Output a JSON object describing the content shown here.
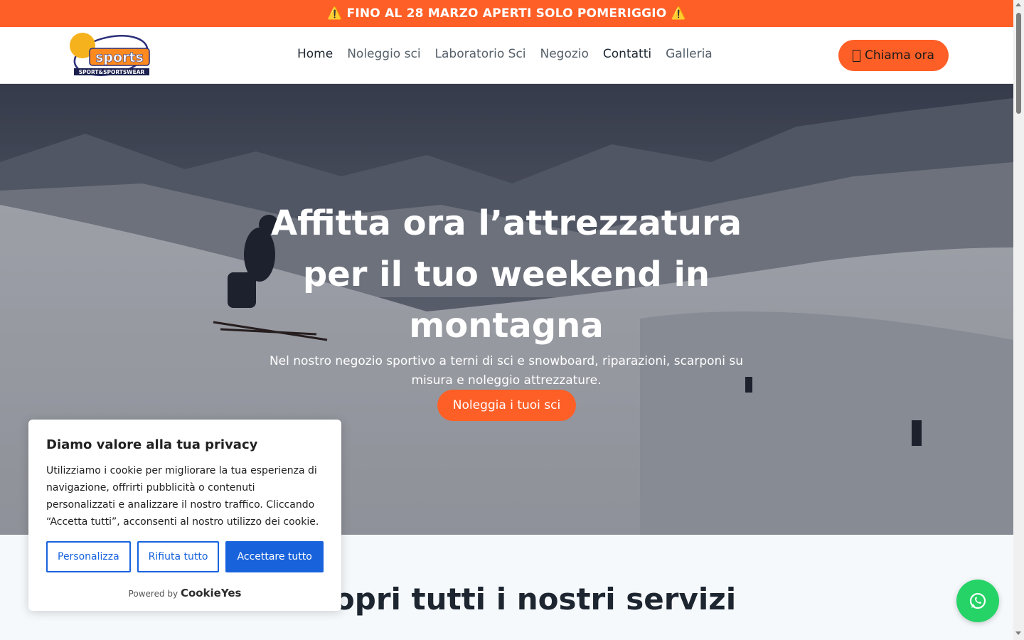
{
  "announcement": "⚠️ FINO AL 28 MARZO APERTI SOLO POMERIGGIO ⚠️",
  "logo": {
    "text": "sports",
    "tagline": "SPORT&SPORTSWEAR"
  },
  "nav": {
    "items": [
      "Home",
      "Noleggio sci",
      "Laboratorio Sci",
      "Negozio",
      "Contatti",
      "Galleria"
    ]
  },
  "call_button": {
    "label": "Chiama ora",
    "icon": "phone-icon"
  },
  "hero": {
    "title_line1": "Affitta ora l’attrezzatura",
    "title_line2": "per il tuo weekend in",
    "title_line3": "montagna",
    "subtitle_line1": "Nel nostro negozio sportivo a terni di sci e snowboard, riparazioni, scarponi su",
    "subtitle_line2": "misura e noleggio attrezzature.",
    "cta": "Noleggia i tuoi sci"
  },
  "services": {
    "title": "copri tutti i nostri servizi"
  },
  "cookie": {
    "title": "Diamo valore alla tua privacy",
    "body": "Utilizziamo i cookie per migliorare la tua esperienza di navigazione, offrirti pubblicità o contenuti personalizzati e analizzare il nostro traffico. Cliccando “Accetta tutti”, acconsenti al nostro utilizzo dei cookie.",
    "btn_customize": "Personalizza",
    "btn_reject": "Rifiuta tutto",
    "btn_accept": "Accettare tutto",
    "powered_prefix": "Powered by",
    "powered_brand": "CookieYes"
  },
  "colors": {
    "brand_orange": "#fe5f27",
    "cookie_blue": "#1863dc",
    "whatsapp_green": "#25d366"
  },
  "floating": {
    "icon": "whatsapp-icon"
  }
}
